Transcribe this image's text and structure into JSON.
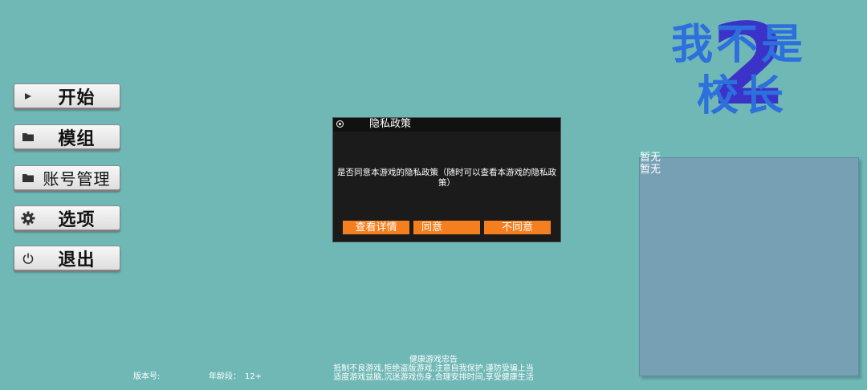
{
  "menu": {
    "start": "开始",
    "mods": "模组",
    "account": "账号管理",
    "options": "选项",
    "exit": "退出"
  },
  "icons": {
    "start": "play-icon",
    "mods": "folder-icon",
    "account": "folder-icon",
    "options": "gear-icon",
    "exit": "power-icon"
  },
  "logo": {
    "line1": "我不是",
    "line2": "校长",
    "number": "2"
  },
  "side_panel": {
    "line1": "暂无",
    "line2": "暂无"
  },
  "dialog": {
    "title": "隐私政策",
    "message": "是否同意本游戏的隐私政策（随时可以查看本游戏的隐私政策）",
    "btn_details": "查看详情",
    "btn_agree": "同意",
    "btn_disagree": "不同意"
  },
  "footer": {
    "version_label": "版本号:",
    "age_label": "年龄段：",
    "age_value": "12+",
    "notice_title": "健康游戏忠告",
    "notice_line1": "抵制不良游戏,拒绝盗版游戏,注意自我保护,谨防受骗上当",
    "notice_line2": "适度游戏益脑,沉迷游戏伤身,合理安排时间,享受健康生活"
  },
  "colors": {
    "background": "#6fb8b6",
    "dialog_button": "#f57f1e",
    "panel": "#77a0b5",
    "logo_text": "#2d6fdc",
    "logo_number": "#3b33c7"
  }
}
